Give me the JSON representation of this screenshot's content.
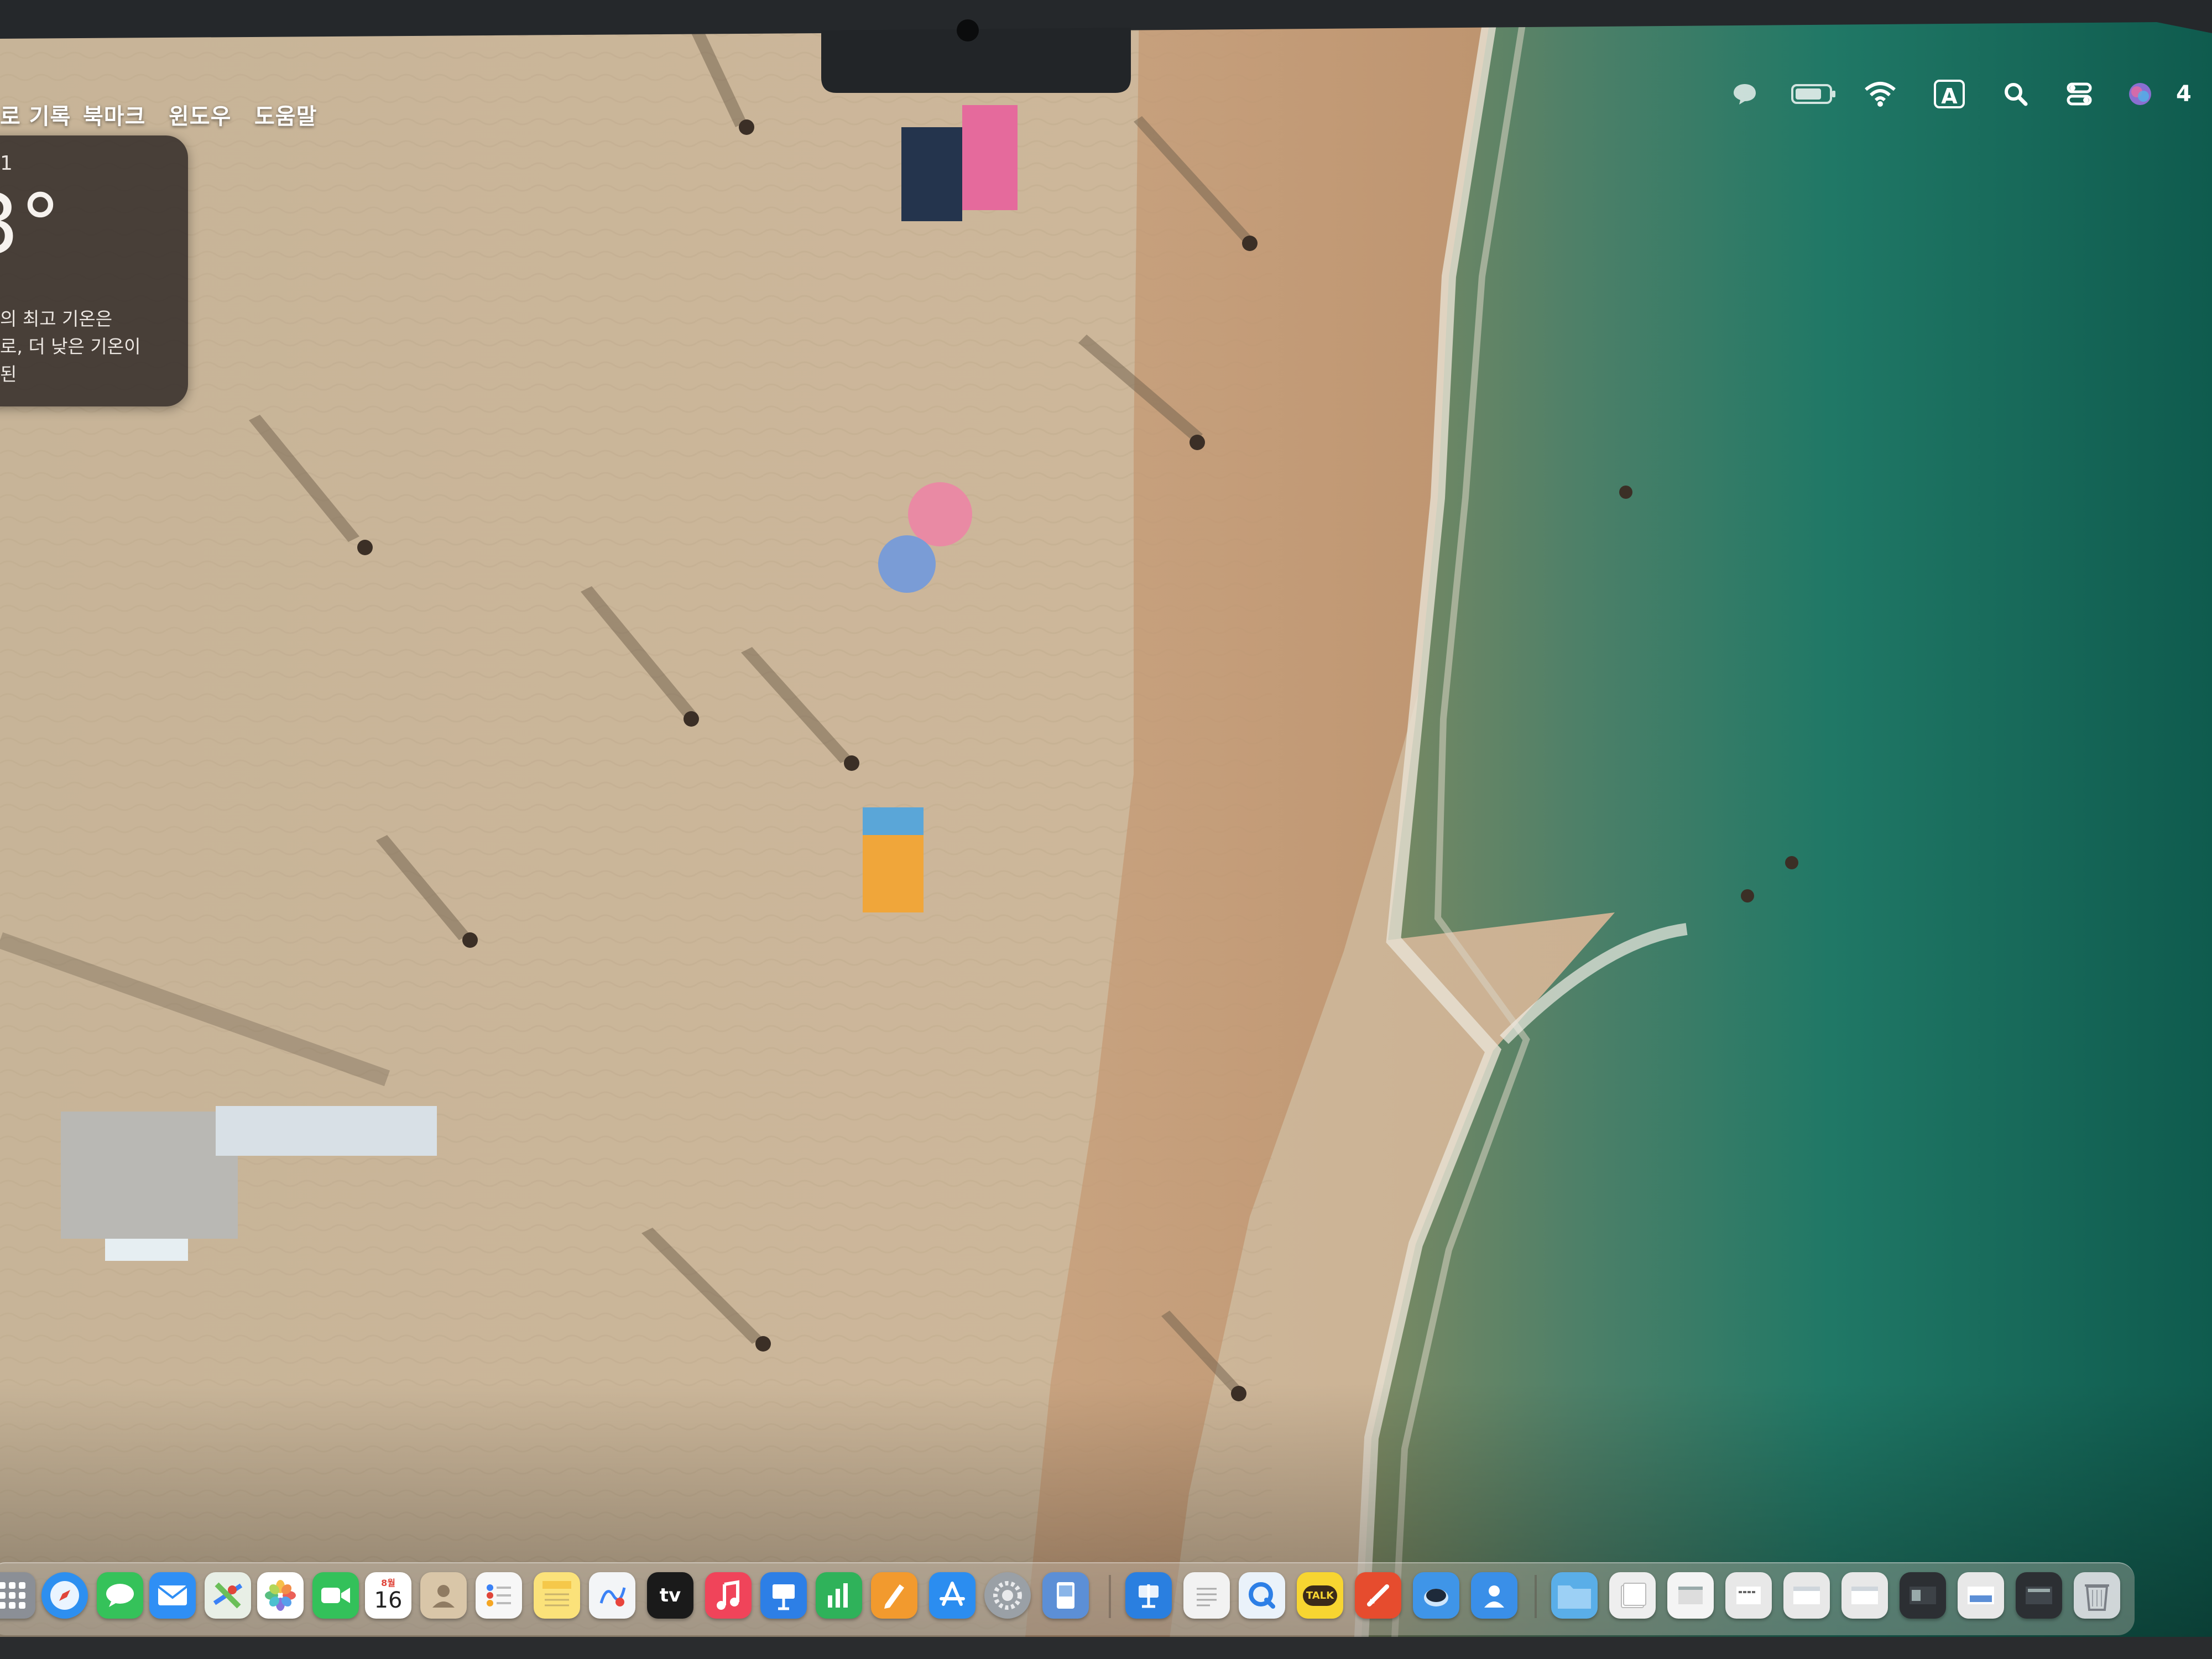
{
  "menubar": {
    "items": [
      "로 기록",
      "북마크",
      "윈도우",
      "도움말"
    ]
  },
  "status_icons": [
    "message-icon",
    "battery-icon",
    "wifi-icon",
    "input-source-icon",
    "spotlight-search-icon",
    "control-center-icon",
    "siri-icon",
    "clock-icon"
  ],
  "status_text": {
    "input_source": "A",
    "clock_partial": "4"
  },
  "weather": {
    "location": "1",
    "temperature": "3°",
    "summary_lines": [
      "의 최고 기온은",
      "로, 더 낮은 기온이",
      "된"
    ]
  },
  "dock": {
    "calendar_day": "16",
    "calendar_month": "8월",
    "tv_label": "tv",
    "kakaotalk_label": "TALK",
    "apps": [
      "launchpad-icon",
      "safari-icon",
      "messages-icon",
      "mail-icon",
      "maps-icon",
      "photos-icon",
      "facetime-icon",
      "calendar-icon",
      "contacts-icon",
      "reminders-icon",
      "notes-icon",
      "freeform-icon",
      "apple-tv-icon",
      "music-icon",
      "keynote-icon",
      "numbers-icon",
      "pages-icon",
      "app-store-icon",
      "system-settings-icon",
      "preview-icon",
      "keynote-alt-icon",
      "textedit-icon",
      "quicktime-icon",
      "kakaotalk-icon",
      "zoom-icon",
      "finder-alt-icon",
      "person-icon",
      "downloads-folder-icon",
      "document-stack-icon",
      "window-thumbnail-icon",
      "trash-icon"
    ]
  },
  "colors": {
    "sand": "#c8b396",
    "sea": "#1f7a66",
    "menubar_text": "#ffffff",
    "widget_bg": "#3a322e"
  }
}
